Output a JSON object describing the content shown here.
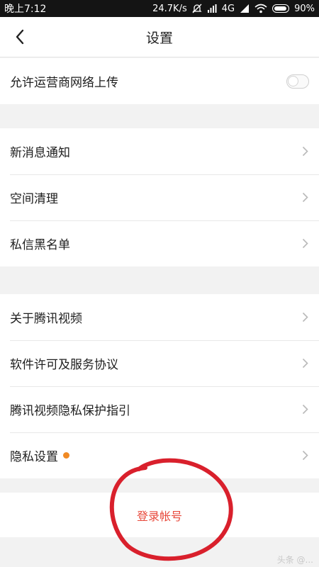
{
  "status_bar": {
    "time": "晚上7:12",
    "speed": "24.7K/s",
    "network": "4G",
    "battery": "90%"
  },
  "header": {
    "title": "设置"
  },
  "settings": {
    "upload_on_carrier_label": "允许运营商网络上传",
    "upload_on_carrier_enabled": false,
    "group2": [
      "新消息通知",
      "空间清理",
      "私信黑名单"
    ],
    "group3": [
      "关于腾讯视频",
      "软件许可及服务协议",
      "腾讯视频隐私保护指引",
      "隐私设置"
    ]
  },
  "login": {
    "label": "登录帐号"
  },
  "colors": {
    "accent_red": "#e84a3c",
    "dot_orange": "#f08a24",
    "annotation_red": "#d9202c"
  },
  "watermark": "头条 @..."
}
